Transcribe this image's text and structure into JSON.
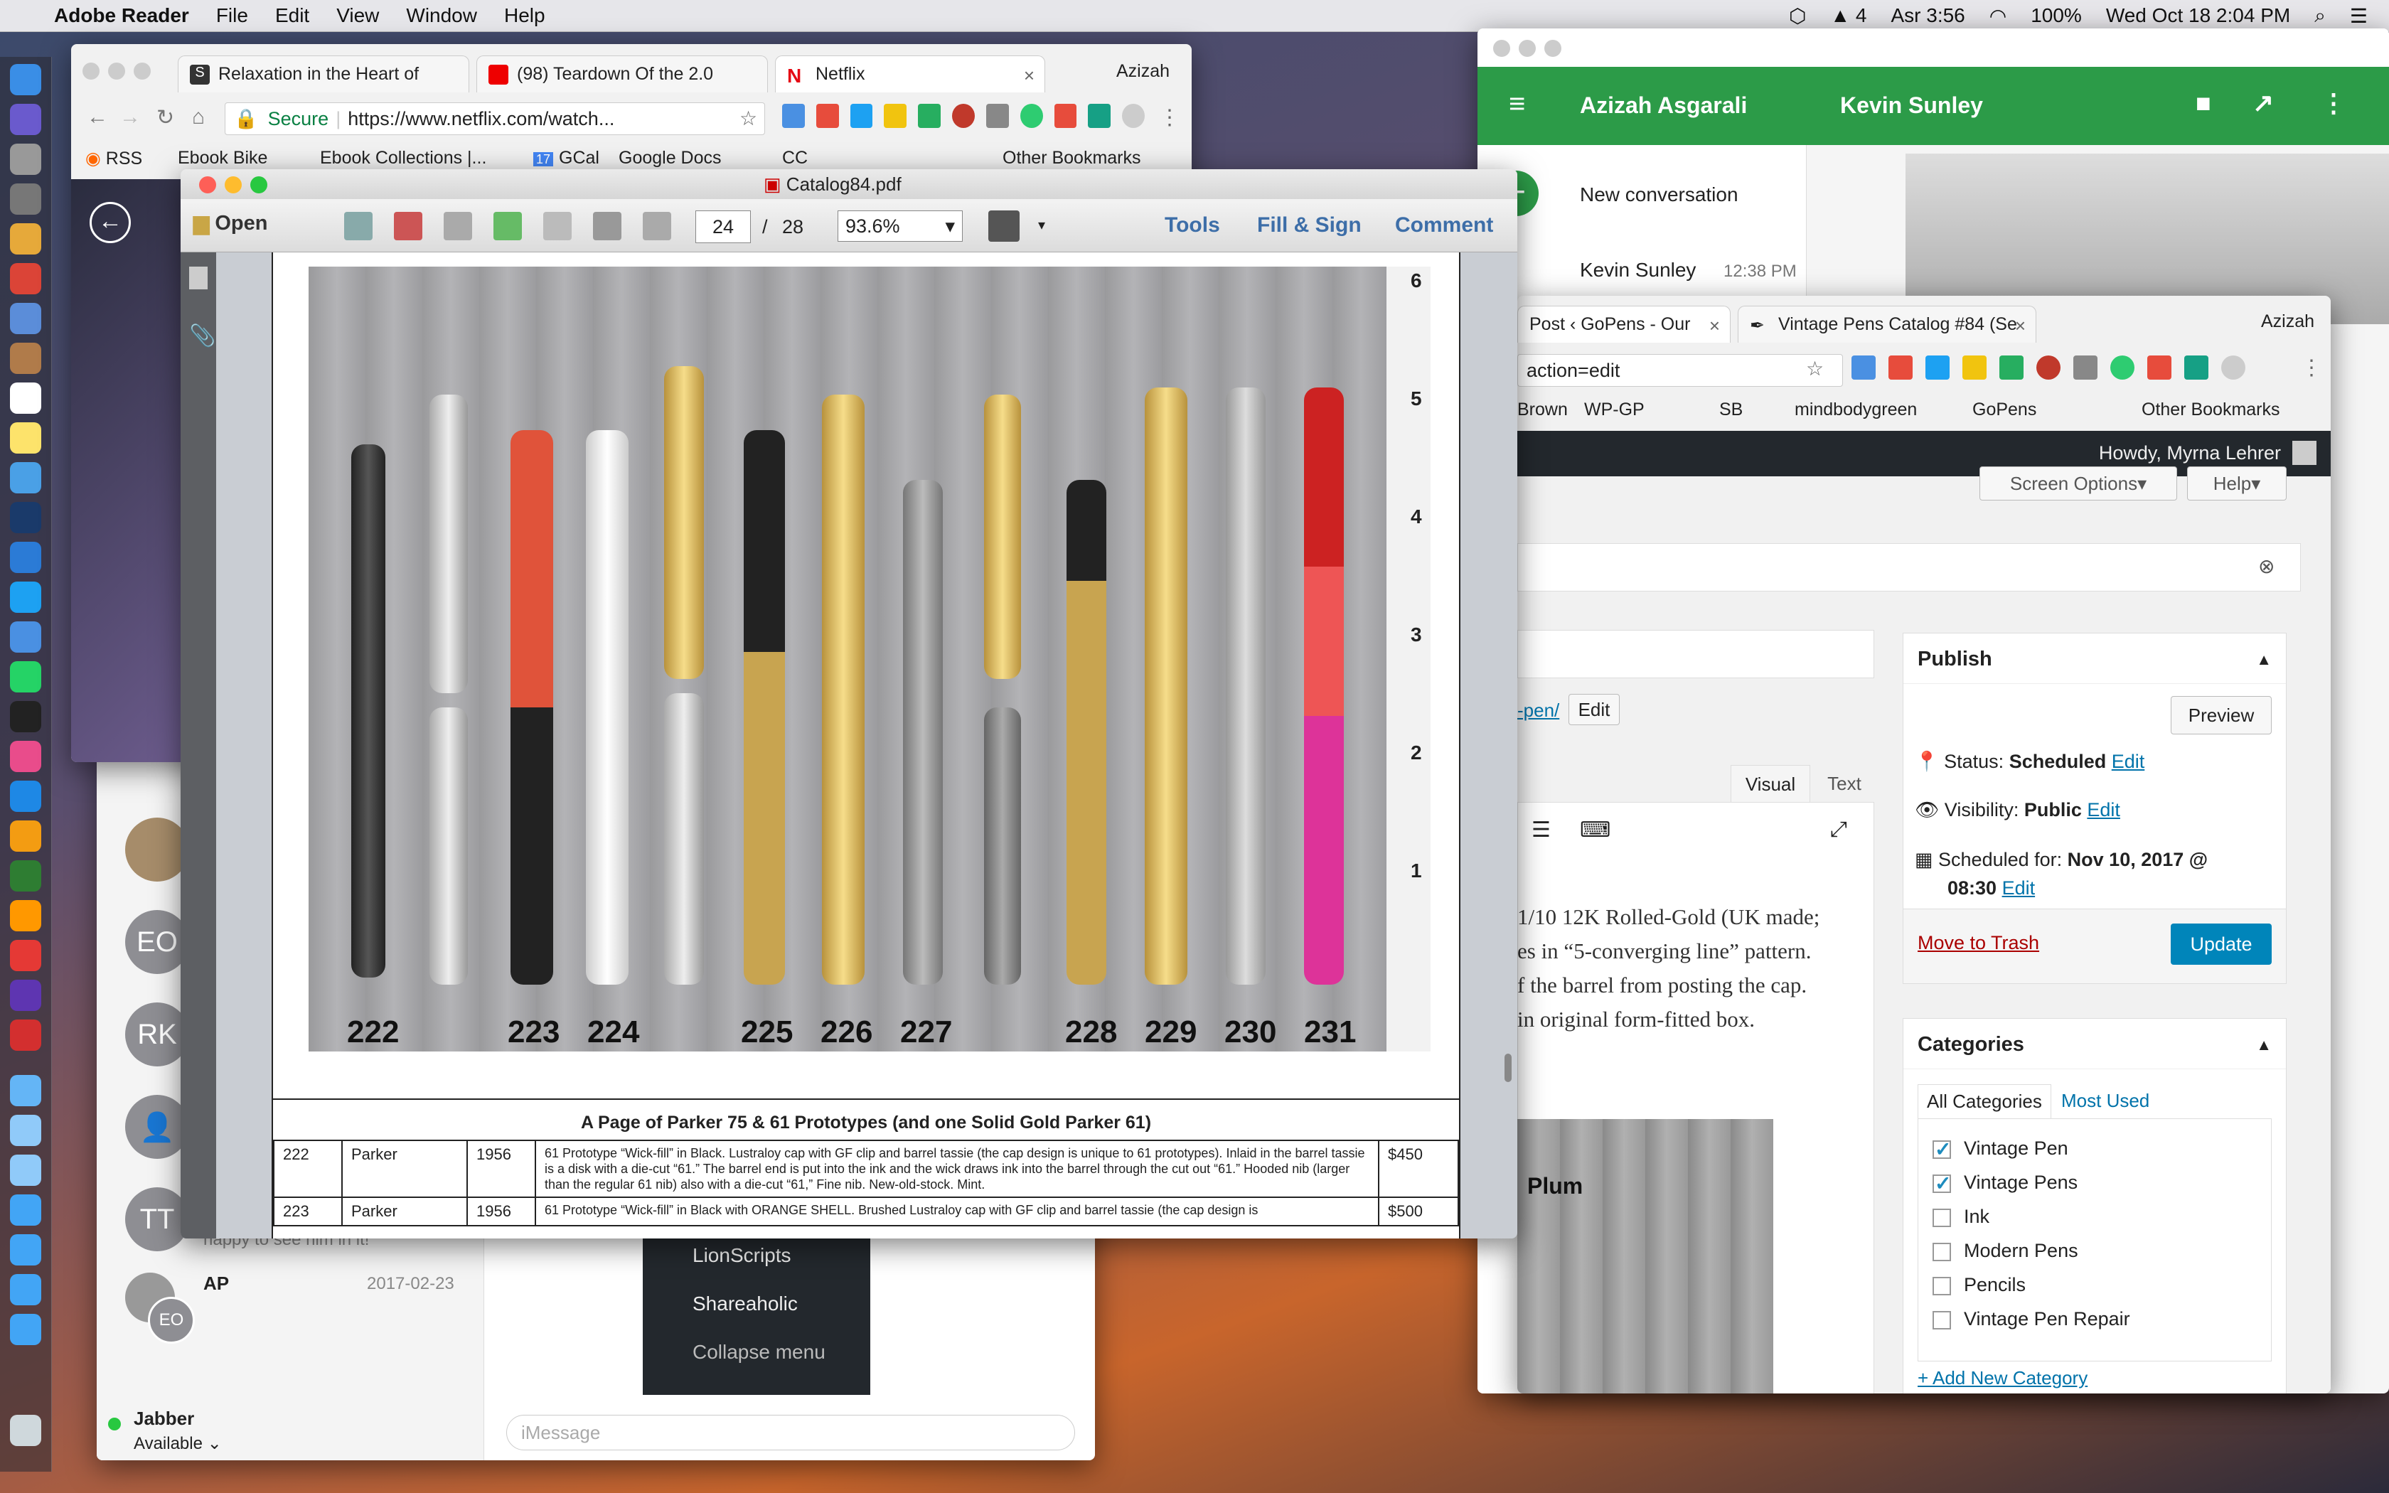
{
  "menubar": {
    "app_name": "Adobe Reader",
    "menus": [
      "File",
      "Edit",
      "View",
      "Window",
      "Help"
    ],
    "status": {
      "ai_badge": "4",
      "prayer": "Asr 3:56",
      "battery": "100%",
      "clock": "Wed Oct 18  2:04 PM"
    }
  },
  "chrome_netflix": {
    "tabs": [
      {
        "label": "Relaxation in the Heart of",
        "icon": "S"
      },
      {
        "label": "(98) Teardown Of the 2.0",
        "icon": "youtube"
      },
      {
        "label": "Netflix",
        "icon": "N"
      }
    ],
    "profile": "Azizah",
    "secure_label": "Secure",
    "url": "https://www.netflix.com/watch...",
    "bookmarks": [
      "RSS",
      "Ebook Bike",
      "Ebook Collections |...",
      "GCal",
      "Google Docs",
      "CC"
    ],
    "other_bookmarks": "Other Bookmarks",
    "gcal_badge": "17"
  },
  "reader": {
    "title": "Catalog84.pdf",
    "open_label": "Open",
    "page_current": "24",
    "page_sep": "/",
    "page_total": "28",
    "zoom": "93.6%",
    "tools": "Tools",
    "fill_sign": "Fill & Sign",
    "comment": "Comment",
    "pen_numbers": [
      "222",
      "223",
      "224",
      "225",
      "226",
      "227",
      "228",
      "229",
      "230",
      "231"
    ],
    "ruler_marks": [
      "6",
      "5",
      "4",
      "3",
      "2",
      "1"
    ],
    "caption": "A Page of Parker 75 & 61 Prototypes (and one Solid Gold Parker 61)",
    "rows": [
      {
        "num": "222",
        "brand": "Parker",
        "year": "1956",
        "desc": "61 Prototype “Wick-fill” in Black. Lustraloy cap with GF clip and barrel tassie (the cap design is unique to 61 prototypes). Inlaid in the barrel tassie is a disk with a die-cut “61.” The barrel end is put into the ink and the wick draws ink into the barrel through the cut out “61.” Hooded nib (larger than the regular 61 nib) also with a die-cut “61,” Fine nib. New-old-stock. Mint.",
        "price": "$450"
      },
      {
        "num": "223",
        "brand": "Parker",
        "year": "1956",
        "desc": "61 Prototype “Wick-fill” in Black with ORANGE SHELL. Brushed Lustraloy cap with GF clip and barrel tassie (the cap design is",
        "price": "$500"
      }
    ]
  },
  "hangouts": {
    "user1": "Azizah Asgarali",
    "user2": "Kevin Sunley",
    "new_conversation": "New conversation",
    "contact": "Kevin Sunley",
    "contact_time": "12:38 PM"
  },
  "chrome_wp": {
    "tabs": [
      {
        "label": "Post ‹ GoPens - Our"
      },
      {
        "label": "Vintage Pens Catalog #84 (Se"
      }
    ],
    "profile": "Azizah",
    "url": "action=edit",
    "bookmarks": [
      "Brown",
      "WP-GP",
      "SB",
      "mindbodygreen",
      "GoPens"
    ],
    "other_bookmarks": "Other Bookmarks",
    "howdy": "Howdy, Myrna Lehrer",
    "screen_options": "Screen Options",
    "help": "Help",
    "permalink_tail": "-pen/",
    "edit_btn": "Edit",
    "tab_visual": "Visual",
    "tab_text": "Text",
    "body_lines": [
      "1/10 12K Rolled-Gold (UK made;",
      "es in “5-converging line” pattern.",
      "f the barrel from posting the cap.",
      "in original form-fitted box."
    ],
    "img_label": "Plum",
    "publish": {
      "title": "Publish",
      "preview": "Preview",
      "status_label": "Status:",
      "status_value": "Scheduled",
      "visibility_label": "Visibility:",
      "visibility_value": "Public",
      "scheduled_label": "Scheduled for:",
      "scheduled_value": "Nov 10, 2017 @",
      "scheduled_time": "08:30",
      "edit": "Edit",
      "trash": "Move to Trash",
      "update": "Update"
    },
    "categories": {
      "title": "Categories",
      "tab_all": "All Categories",
      "tab_used": "Most Used",
      "items": [
        {
          "label": "Vintage Pen",
          "checked": true
        },
        {
          "label": "Vintage Pens",
          "checked": true
        },
        {
          "label": "Ink",
          "checked": false
        },
        {
          "label": "Modern Pens",
          "checked": false
        },
        {
          "label": "Pencils",
          "checked": false
        },
        {
          "label": "Vintage Pen Repair",
          "checked": false
        }
      ],
      "add_new": "+ Add New Category"
    }
  },
  "messages": {
    "avatars": [
      "EO",
      "RK",
      "TT"
    ],
    "snippet": "happy to see him in it!",
    "ap_name": "AP",
    "ap_date": "2017-02-23",
    "ap_avatar": "EO",
    "jabber": "Jabber",
    "status": "Available",
    "input_placeholder": "iMessage"
  },
  "wp_menu": {
    "items": [
      "LionScripts",
      "Shareaholic",
      "Collapse menu"
    ]
  },
  "colors": {
    "hangouts_green": "#2c9b48",
    "wp_blue": "#0085ba",
    "trash_red": "#a00"
  }
}
